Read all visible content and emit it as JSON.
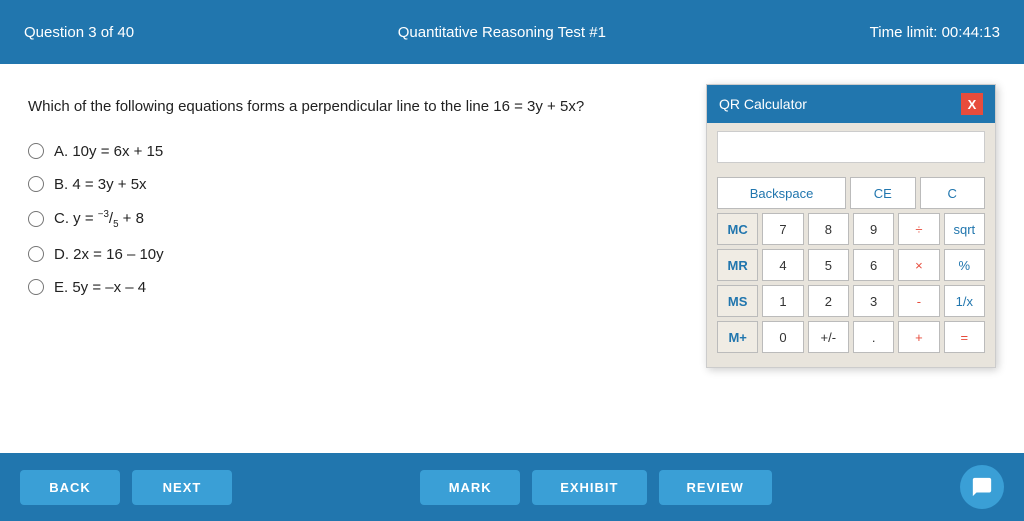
{
  "header": {
    "question_counter": "Question 3 of 40",
    "test_title": "Quantitative Reasoning Test #1",
    "time_limit_label": "Time limit: 00:44:13"
  },
  "question": {
    "text": "Which of the following equations forms a perpendicular line to the line 16 = 3y + 5x?",
    "options": [
      {
        "id": "A",
        "label": "A.",
        "text": "10y = 6x + 15"
      },
      {
        "id": "B",
        "label": "B.",
        "text": "4 = 3y + 5x"
      },
      {
        "id": "C",
        "label": "C.",
        "text": "y = ⁻³⁵ + 8"
      },
      {
        "id": "D",
        "label": "D.",
        "text": "2x = 16 – 10y"
      },
      {
        "id": "E",
        "label": "E.",
        "text": "5y = –x – 4"
      }
    ]
  },
  "calculator": {
    "title": "QR Calculator",
    "close_label": "X",
    "rows": [
      [
        {
          "label": "Backspace",
          "type": "special",
          "colspan": 2
        },
        {
          "label": "CE",
          "type": "special"
        },
        {
          "label": "C",
          "type": "special"
        }
      ],
      [
        {
          "label": "MC",
          "type": "memory"
        },
        {
          "label": "7",
          "type": "digit"
        },
        {
          "label": "8",
          "type": "digit"
        },
        {
          "label": "9",
          "type": "digit"
        },
        {
          "label": "÷",
          "type": "operator"
        },
        {
          "label": "sqrt",
          "type": "special"
        }
      ],
      [
        {
          "label": "MR",
          "type": "memory"
        },
        {
          "label": "4",
          "type": "digit"
        },
        {
          "label": "5",
          "type": "digit"
        },
        {
          "label": "6",
          "type": "digit"
        },
        {
          "label": "×",
          "type": "operator"
        },
        {
          "label": "%",
          "type": "special"
        }
      ],
      [
        {
          "label": "MS",
          "type": "memory"
        },
        {
          "label": "1",
          "type": "digit"
        },
        {
          "label": "2",
          "type": "digit"
        },
        {
          "label": "3",
          "type": "digit"
        },
        {
          "label": "-",
          "type": "operator"
        },
        {
          "label": "1/x",
          "type": "special"
        }
      ],
      [
        {
          "label": "M+",
          "type": "memory"
        },
        {
          "label": "0",
          "type": "digit"
        },
        {
          "label": "+/-",
          "type": "digit"
        },
        {
          "label": ".",
          "type": "digit"
        },
        {
          "label": "+",
          "type": "operator"
        },
        {
          "label": "=",
          "type": "operator"
        }
      ]
    ]
  },
  "footer": {
    "back_label": "BACK",
    "next_label": "NEXT",
    "mark_label": "MARK",
    "exhibit_label": "EXHIBIT",
    "review_label": "REVIEW"
  }
}
